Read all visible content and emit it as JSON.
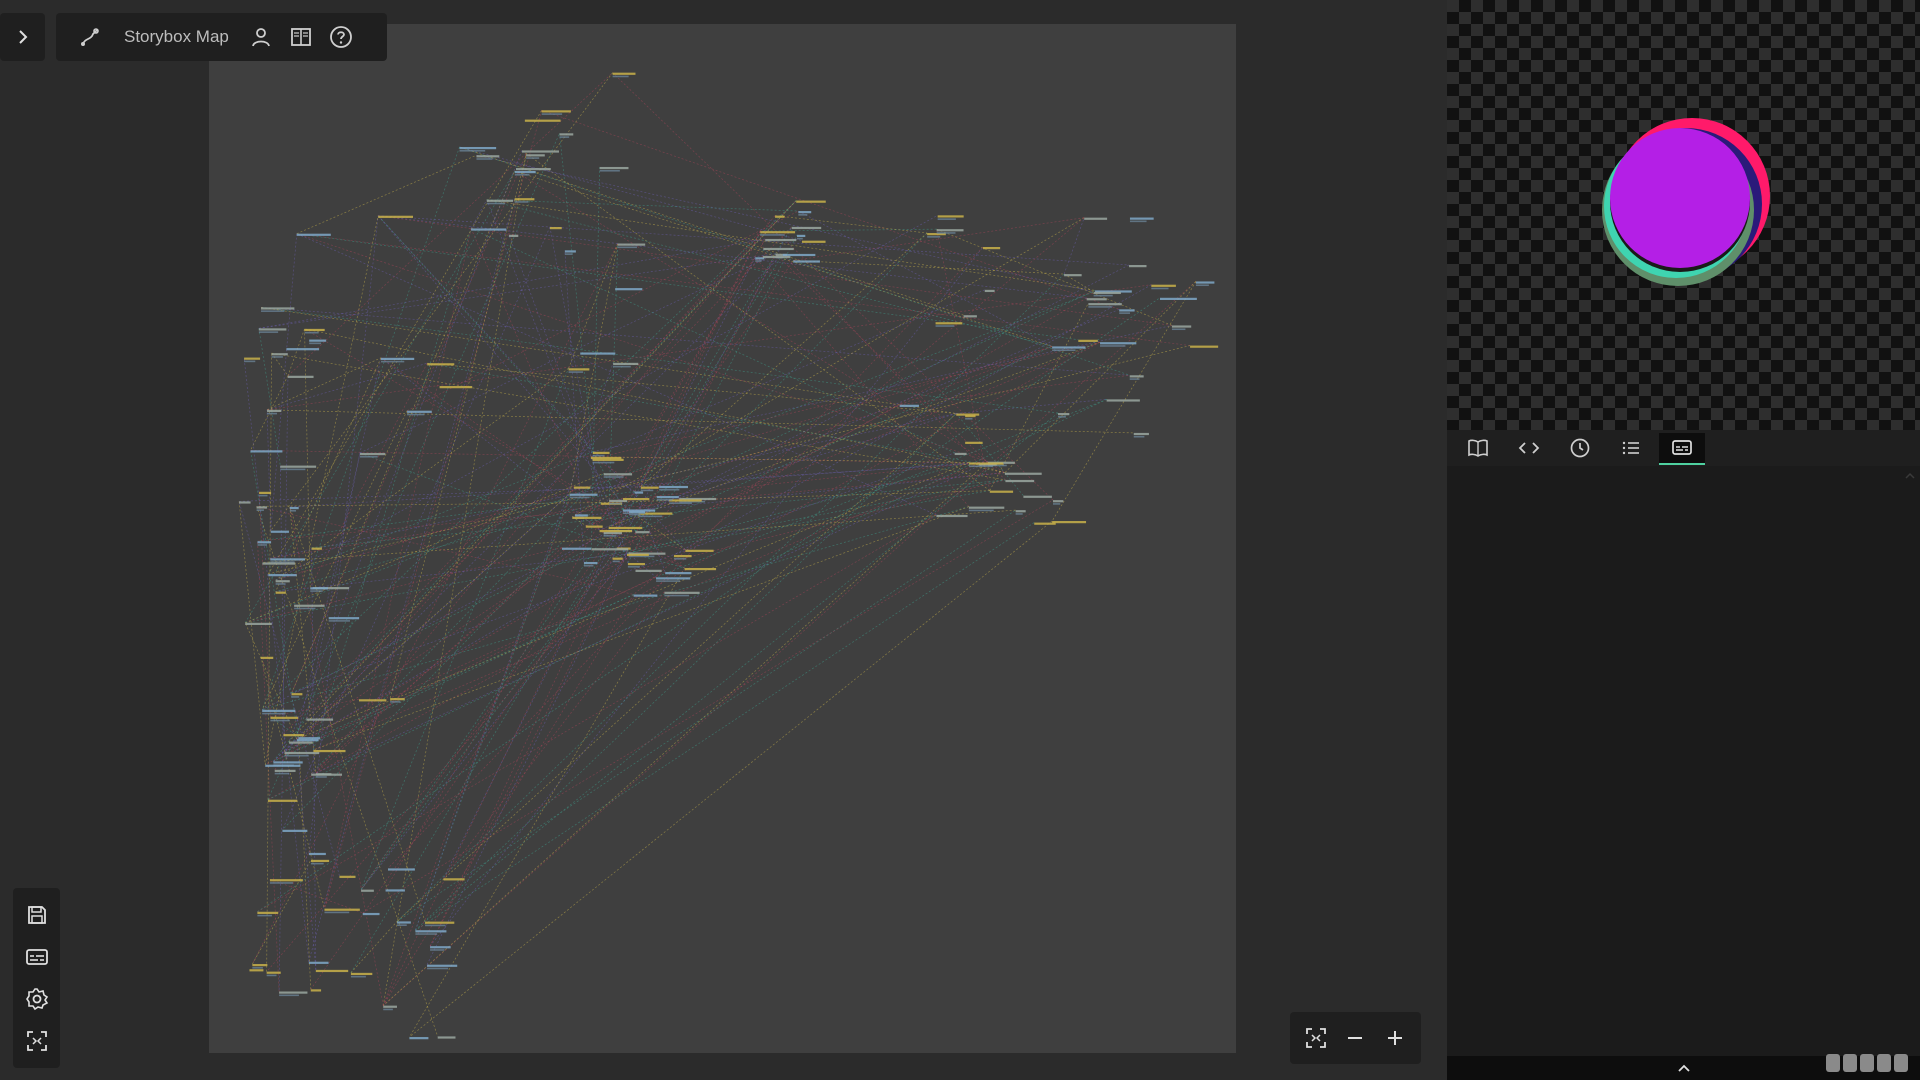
{
  "toolbar": {
    "title": "Storybox Map",
    "icons": [
      "path-tool-icon",
      "user-icon",
      "book-open-icon",
      "help-circle-icon"
    ]
  },
  "sidebar_toggle": {
    "icon": "chevron-right-icon"
  },
  "left_tools": [
    "save-icon",
    "subtitles-icon",
    "gear-icon",
    "focus-frame-icon"
  ],
  "zoom_controls": [
    "fit-view-icon",
    "minus-icon",
    "plus-icon"
  ],
  "right_panel": {
    "tabs": [
      "book-icon",
      "code-icon",
      "clock-icon",
      "list-icon",
      "subtitles-icon"
    ],
    "active_tab": 4,
    "bottom_toggle": "chevron-up-icon",
    "logo": "brand-logo"
  },
  "colors": {
    "accent_green": "#4fd1a0",
    "edge_yellow": "#c9b24a",
    "edge_teal": "#3f9e8c",
    "edge_red": "#a8455a",
    "edge_purple": "#6b5fb0",
    "preview_magenta": "#b41fe6",
    "preview_pink": "#ff1a6a"
  }
}
